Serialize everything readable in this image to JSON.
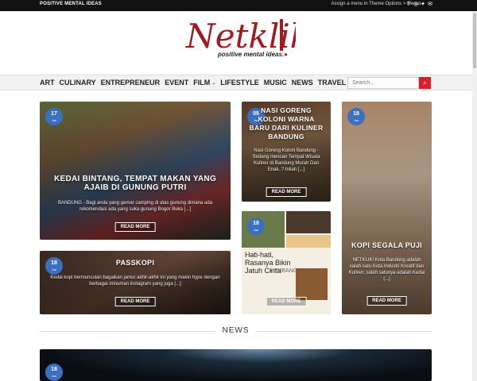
{
  "topbar": {
    "tagline": "POSITIVE MENTAL IDEAS",
    "assign_text": "Assign a menu in Theme Options > Menus",
    "social_icons": [
      "facebook-icon",
      "instagram-icon",
      "twitter-icon",
      "mail-icon"
    ]
  },
  "logo": {
    "text": "Netklik",
    "tagline": "positive mental ideas."
  },
  "nav": {
    "items": [
      {
        "label": "ART"
      },
      {
        "label": "CULINARY"
      },
      {
        "label": "ENTREPRENEUR"
      },
      {
        "label": "EVENT"
      },
      {
        "label": "FILM"
      },
      {
        "label": "LIFESTYLE"
      },
      {
        "label": "MUSIC"
      },
      {
        "label": "NEWS"
      },
      {
        "label": "TRAVEL"
      }
    ],
    "search_placeholder": "Search..."
  },
  "colors": {
    "accent": "#d71e2c",
    "badge": "#3b6fbf",
    "brand": "#a11a22"
  },
  "posts": [
    {
      "day": "17",
      "month": "Jun",
      "title": "KEDAI BINTANG, TEMPAT MAKAN YANG AJAIB DI GUNUNG PUTRI",
      "excerpt": "BANDUNG - Bagi anda yang gemar camping di atas gunung dimana ada rekomendasi ada yang suka gunung Bogor Buka [...]",
      "more": "READ MORE"
    },
    {
      "day": "05",
      "month": "Jun",
      "title": "NASI GORENG KOLONI WARNA BARU DARI KULINER BANDUNG",
      "excerpt": "Nasi Goreng Koloni Bandung - Sedang mencari Tempat Wisata Kuliner di Bandung Murah Dan Enak..? Inilah [...]",
      "more": "READ MORE"
    },
    {
      "day": "18",
      "month": "Jun",
      "title": "KOPI SEGALA PUJI",
      "excerpt": "NETKLIK! Kota Bandung adalah salah satu Kota Industri Kreatif dan Kuliner, salah satunya adalah Kedai [...]",
      "more": "READ MORE"
    },
    {
      "day": "18",
      "month": "Jun",
      "title": "PASSKOPI",
      "excerpt": "Kedai kopi bermunculan bagaikan jamur akhir-akhir ini yang makin hype dengan berbagai minuman instagram yang juga [...]",
      "more": "READ MORE"
    },
    {
      "day": "18",
      "month": "Jun",
      "title": "",
      "excerpt": "",
      "image_text": "Hati-hati, Rasanya Bikin Jatuh Cinta",
      "image_subtext": "LEMBANG",
      "more": "READ MORE"
    },
    {
      "day": "18",
      "month": "Jun"
    }
  ],
  "sections": {
    "news": "NEWS"
  }
}
